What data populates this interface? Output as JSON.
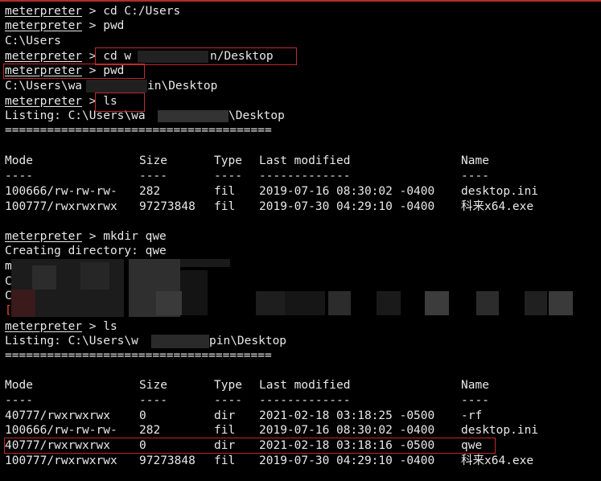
{
  "prompt": "meterpreter",
  "lines": {
    "l1_cmd": " > cd C:/Users",
    "l2_cmd": " > pwd",
    "l3": "C:\\Users",
    "l4_cmd": " > cd w",
    "l4_tail": "n/Desktop",
    "l5_cmd": " > pwd",
    "l6_head": "C:\\Users\\wa",
    "l6_tail": "in\\Desktop",
    "l7_cmd": " > ls",
    "l8_head": "Listing: C:\\Users\\wa",
    "l8_tail": "\\Desktop",
    "l9": "======================================",
    "l20_cmd": " > mkdir qwe",
    "l21": "Creating directory: qwe",
    "l22_frag": "m",
    "l23_frag": "C",
    "l24_frag": "C",
    "l25_frag": "[",
    "l26_cmd": " > ls",
    "l27_head": "Listing: C:\\Users\\w",
    "l27_tail": "pin\\Desktop",
    "l28": "======================================"
  },
  "table1": {
    "headers": [
      "Mode",
      "Size",
      "Type",
      "Last modified",
      "Name"
    ],
    "dashes": [
      "----",
      "----",
      "----",
      "-------------",
      "----"
    ],
    "rows": [
      [
        "100666/rw-rw-rw-",
        "282",
        "fil",
        "2019-07-16 08:30:02 -0400",
        "desktop.ini"
      ],
      [
        "100777/rwxrwxrwx",
        "97273848",
        "fil",
        "2019-07-30 04:29:10 -0400",
        "科来x64.exe"
      ]
    ]
  },
  "table2": {
    "headers": [
      "Mode",
      "Size",
      "Type",
      "Last modified",
      "Name"
    ],
    "dashes": [
      "----",
      "----",
      "----",
      "-------------",
      "----"
    ],
    "rows": [
      [
        "40777/rwxrwxrwx",
        "0",
        "dir",
        "2021-02-18 03:18:25 -0500",
        "-rf"
      ],
      [
        "100666/rw-rw-rw-",
        "282",
        "fil",
        "2019-07-16 08:30:02 -0400",
        "desktop.ini"
      ],
      [
        "40777/rwxrwxrwx",
        "0",
        "dir",
        "2021-02-18 03:18:16 -0500",
        "qwe"
      ],
      [
        "100777/rwxrwxrwx",
        "97273848",
        "fil",
        "2019-07-30 04:29:10 -0400",
        "科来x64.exe"
      ]
    ]
  },
  "colors": {
    "background": "#000000",
    "text": "#e8e8e8",
    "highlight_box": "#c0282c"
  }
}
